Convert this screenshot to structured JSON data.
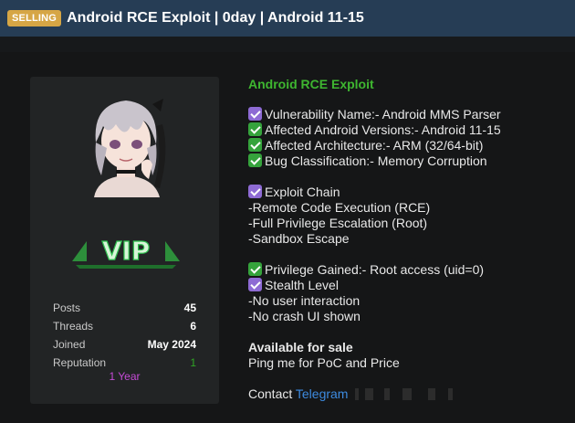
{
  "thread": {
    "prefix": "Selling",
    "title": "Android RCE Exploit | 0day | Android 11-15"
  },
  "user": {
    "badge_text": "VIP",
    "stats": [
      {
        "label": "Posts",
        "value": "45"
      },
      {
        "label": "Threads",
        "value": "6"
      },
      {
        "label": "Joined",
        "value": "May 2024"
      },
      {
        "label": "Reputation",
        "value": "1"
      }
    ],
    "tenure": "1 Year"
  },
  "post": {
    "heading": "Android RCE Exploit",
    "vuln_name": "Vulnerability Name:- Android MMS Parser",
    "affected_versions": "Affected Android Versions:- Android 11-15",
    "affected_arch": "Affected Architecture:- ARM (32/64-bit)",
    "bug_class": "Bug Classification:- Memory Corruption",
    "exploit_chain": "Exploit Chain",
    "chain_items": [
      "-Remote Code Execution (RCE)",
      "-Full Privilege Escalation (Root)",
      "-Sandbox Escape"
    ],
    "privilege": "Privilege Gained:- Root access (uid=0)",
    "stealth": "Stealth Level",
    "stealth_items": [
      "-No user interaction",
      "-No crash UI shown"
    ],
    "available": "Available for sale",
    "ping": "Ping me for PoC and Price",
    "contact_label": "Contact",
    "contact_link": "Telegram"
  },
  "icons": {
    "checkbox_purple": "#8e6bd4",
    "checkbox_green": "#35a33c"
  },
  "colors": {
    "header_bg": "#263d55",
    "prefix_bg": "#d6a645",
    "heading_green": "#3eb630",
    "link_blue": "#3d8be0",
    "tenure_purple": "#c54bd6"
  }
}
